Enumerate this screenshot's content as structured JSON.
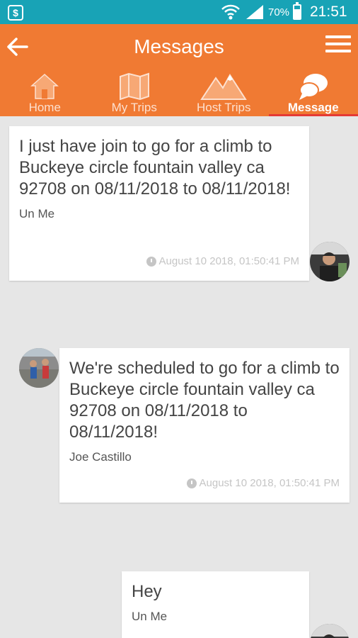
{
  "status_bar": {
    "battery": "70%",
    "battery_level": 0.7,
    "time": "21:51",
    "icons": [
      "app-notification-icon",
      "wifi-icon",
      "signal-icon",
      "battery-icon"
    ]
  },
  "header": {
    "title": "Messages",
    "back_icon": "arrow-left-icon",
    "menu_icon": "hamburger-menu-icon"
  },
  "tabs": [
    {
      "label": "Home",
      "icon": "home-icon",
      "active": false
    },
    {
      "label": "My Trips",
      "icon": "map-icon",
      "active": false
    },
    {
      "label": "Host Trips",
      "icon": "mountain-icon",
      "active": false
    },
    {
      "label": "Message",
      "icon": "chat-bubbles-icon",
      "active": true
    }
  ],
  "messages": [
    {
      "text": "I just have join to go for a climb to Buckeye circle fountain valley ca 92708 on 08/11/2018 to 08/11/2018!",
      "sender": "Un Me",
      "time": "August 10 2018, 01:50:41 PM",
      "side": "right"
    },
    {
      "text": "We're scheduled to go for a climb to Buckeye circle fountain valley ca 92708 on 08/11/2018 to 08/11/2018!",
      "sender": "Joe Castillo",
      "time": "August 10 2018, 01:50:41 PM",
      "side": "left"
    },
    {
      "text": "Hey",
      "sender": "Un Me",
      "side": "right"
    }
  ],
  "colors": {
    "status_bar": "#18a3b6",
    "app_bar": "#f07a33",
    "active_tab_indicator": "#e53935",
    "background": "#e6e6e6"
  }
}
